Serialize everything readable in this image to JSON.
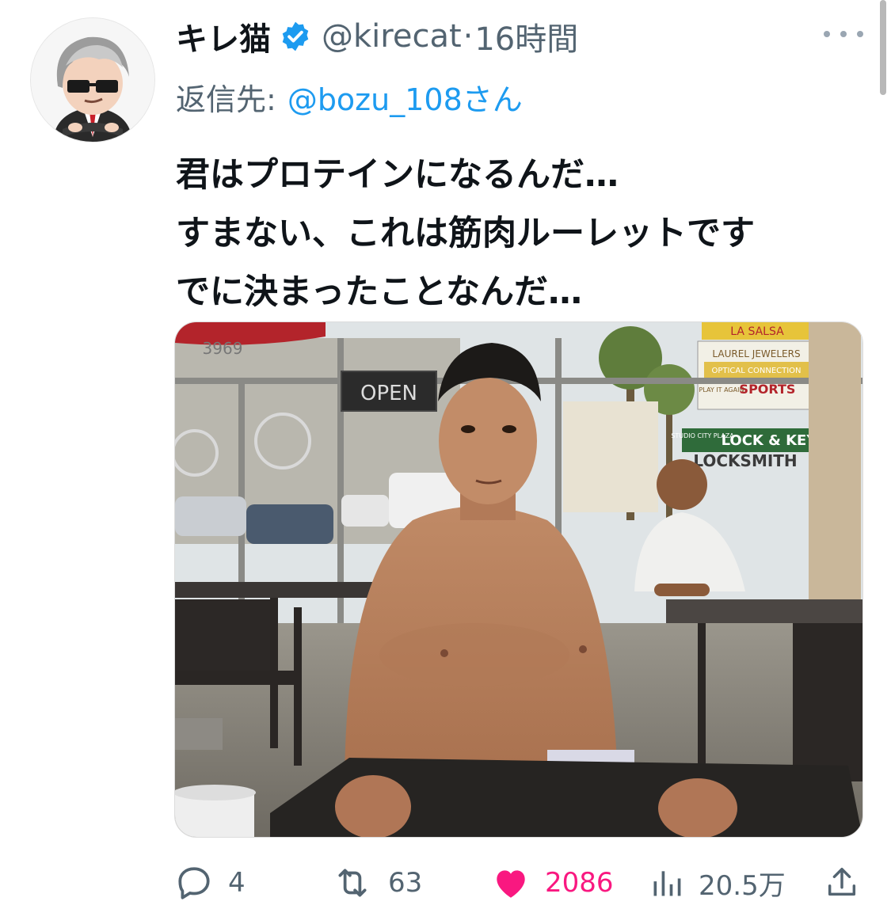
{
  "tweet": {
    "author_name": "キレ猫",
    "author_handle": "@kirecat",
    "separator": "·",
    "timestamp": "16時間",
    "reply_label": "返信先:",
    "reply_handle": "@bozu_108さん",
    "text_lines": [
      "君はプロテインになるんだ…",
      "すまない、これは筋肉ルーレットです",
      "でに決まったことなんだ…"
    ]
  },
  "media": {
    "signs": {
      "sign1": "LA SALSA",
      "sign2": "LAUREL JEWELERS",
      "sign3": "OPTICAL CONNECTION",
      "sign4": "PLAY IT AGAIN",
      "sign5": "SPORTS",
      "sign6": "STUDIO CITY PLAZA",
      "sign7": "LOCK & KEY",
      "sign8": "LOCKSMITH",
      "sign9": "OPEN",
      "sign10": "3969"
    }
  },
  "actions": {
    "replies": "4",
    "retweets": "63",
    "likes": "2086",
    "views": "20.5万"
  },
  "colors": {
    "accent": "#1d9bf0",
    "like": "#f91880",
    "secondary_text": "#536471",
    "primary_text": "#0f1419"
  },
  "icons": {
    "verified": "verified-badge-icon",
    "more": "more-dots-icon",
    "reply": "reply-bubble-icon",
    "retweet": "retweet-icon",
    "like": "heart-icon",
    "views": "views-bars-icon",
    "share": "share-icon"
  }
}
